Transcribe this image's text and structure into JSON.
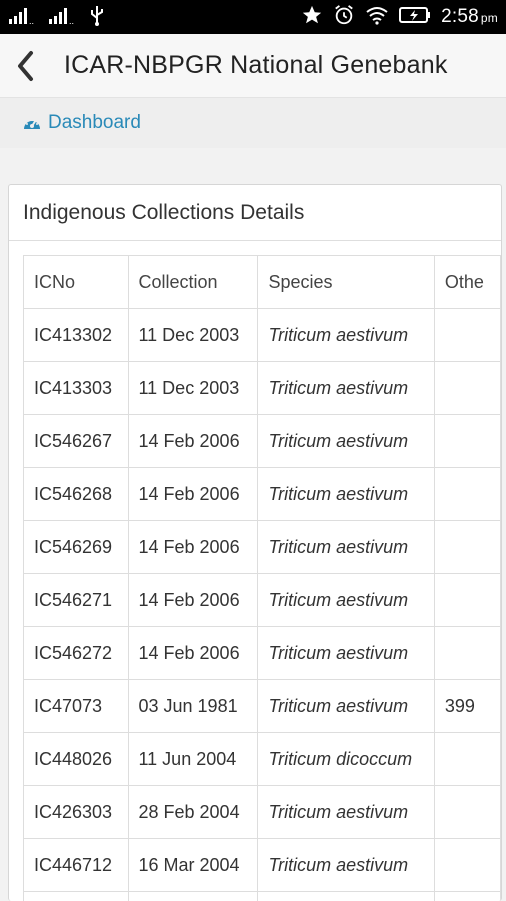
{
  "status_bar": {
    "time": "2:58",
    "ampm": "pm",
    "icons": [
      "signal-icon",
      "signal-icon",
      "usb-icon",
      "star-icon",
      "alarm-icon",
      "wifi-icon",
      "battery-icon"
    ]
  },
  "app_bar": {
    "title": "ICAR-NBPGR National Genebank",
    "back_icon": "chevron-left-icon"
  },
  "breadcrumb": {
    "icon": "dashboard-icon",
    "label": "Dashboard",
    "color": "#2a8ab8"
  },
  "panel": {
    "title": "Indigenous Collections Details"
  },
  "table": {
    "columns": [
      "ICNo",
      "Collection",
      "Species",
      "Othe"
    ],
    "rows": [
      {
        "icno": "IC413302",
        "collection": "11 Dec 2003",
        "species": "Triticum aestivum",
        "other": ""
      },
      {
        "icno": "IC413303",
        "collection": "11 Dec 2003",
        "species": "Triticum aestivum",
        "other": ""
      },
      {
        "icno": "IC546267",
        "collection": "14 Feb 2006",
        "species": "Triticum aestivum",
        "other": ""
      },
      {
        "icno": "IC546268",
        "collection": "14 Feb 2006",
        "species": "Triticum aestivum",
        "other": ""
      },
      {
        "icno": "IC546269",
        "collection": "14 Feb 2006",
        "species": "Triticum aestivum",
        "other": ""
      },
      {
        "icno": "IC546271",
        "collection": "14 Feb 2006",
        "species": "Triticum aestivum",
        "other": ""
      },
      {
        "icno": "IC546272",
        "collection": "14 Feb 2006",
        "species": "Triticum aestivum",
        "other": ""
      },
      {
        "icno": "IC47073",
        "collection": "03 Jun 1981",
        "species": "Triticum aestivum",
        "other": "399"
      },
      {
        "icno": "IC448026",
        "collection": "11 Jun 2004",
        "species": "Triticum dicoccum",
        "other": ""
      },
      {
        "icno": "IC426303",
        "collection": "28 Feb 2004",
        "species": "Triticum aestivum",
        "other": ""
      },
      {
        "icno": "IC446712",
        "collection": "16 Mar 2004",
        "species": "Triticum aestivum",
        "other": ""
      },
      {
        "icno": "",
        "collection": "",
        "species": "",
        "other": ""
      }
    ]
  }
}
